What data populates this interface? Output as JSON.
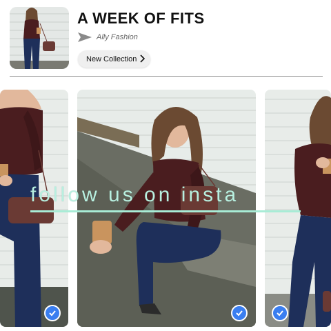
{
  "header": {
    "title": "A WEEK OF FITS",
    "author": "Ally Fashion",
    "button_label": "New Collection"
  },
  "overlay": {
    "text": "follow us on insta"
  },
  "gallery": {
    "cards": [
      {
        "name": "outfit-photo-1",
        "selected": true
      },
      {
        "name": "outfit-photo-2",
        "selected": true
      },
      {
        "name": "outfit-photo-3",
        "selected": true
      }
    ]
  },
  "colors": {
    "accent_check": "#3a7ef0",
    "overlay_text": "#b8f0e0",
    "top": "#4a1d1f",
    "jeans": "#1e2f5a",
    "brick_wall": "#e6ebe8"
  },
  "icons": [
    "send-icon",
    "chevron-right-icon",
    "check-icon"
  ]
}
